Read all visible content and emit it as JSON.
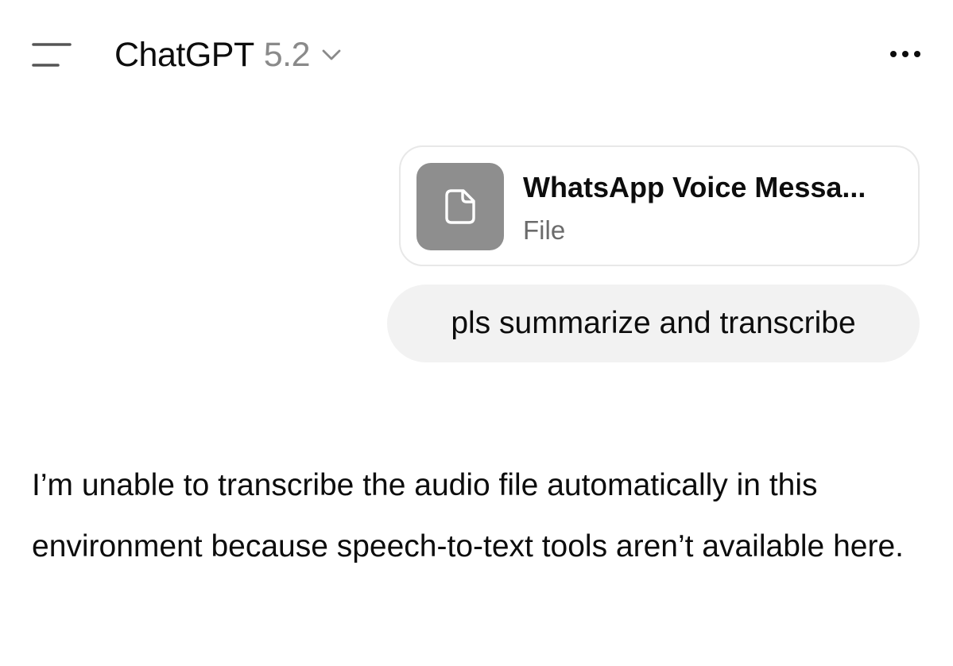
{
  "header": {
    "model_name": "ChatGPT",
    "model_version": "5.2",
    "menu_icon": "sidebar-menu-icon",
    "chevron_icon": "chevron-down-icon",
    "more_icon": "more-horizontal-icon"
  },
  "conversation": {
    "attachment": {
      "name": "WhatsApp Voice Messa...",
      "type": "File",
      "icon": "file-icon",
      "thumb_color": "#8e8e8e"
    },
    "user_message": "pls summarize and transcribe",
    "assistant_message": "I’m unable to transcribe the audio file automatically in this environment because speech-to-text tools aren’t available here."
  }
}
